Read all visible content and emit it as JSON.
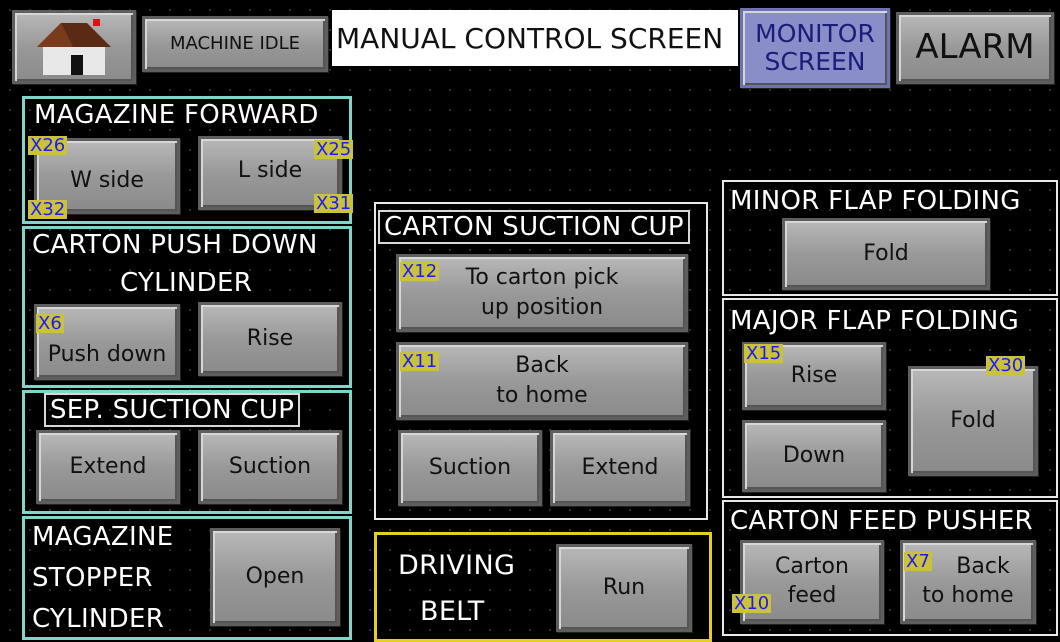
{
  "header": {
    "machine_status": "MACHINE IDLE",
    "screen_title": "MANUAL CONTROL SCREEN",
    "monitor_line1": "MONITOR",
    "monitor_line2": "SCREEN",
    "alarm": "ALARM",
    "home_icon": "home-icon"
  },
  "magazine_forward": {
    "title": "MAGAZINE FORWARD",
    "w_side": "W side",
    "l_side": "L side",
    "tag_x26": "X26",
    "tag_x25": "X25",
    "tag_x32": "X32",
    "tag_x31": "X31"
  },
  "carton_push_down": {
    "title_line1": "CARTON PUSH DOWN",
    "title_line2": "CYLINDER",
    "push_down": "Push down",
    "rise": "Rise",
    "tag_x6": "X6"
  },
  "sep_suction_cup": {
    "title": "SEP. SUCTION CUP",
    "extend": "Extend",
    "suction": "Suction"
  },
  "magazine_stopper": {
    "title_line1": "MAGAZINE",
    "title_line2": "STOPPER",
    "title_line3": "CYLINDER",
    "open": "Open"
  },
  "carton_suction_cup": {
    "title": "CARTON SUCTION CUP",
    "pick_line1": "To carton pick",
    "pick_line2": "up position",
    "back_line1": "Back",
    "back_line2": "to home",
    "suction": "Suction",
    "extend": "Extend",
    "tag_x12": "X12",
    "tag_x11": "X11"
  },
  "driving_belt": {
    "title_line1": "DRIVING",
    "title_line2": "BELT",
    "run": "Run"
  },
  "minor_flap": {
    "title": "MINOR FLAP FOLDING",
    "fold": "Fold"
  },
  "major_flap": {
    "title": "MAJOR FLAP FOLDING",
    "rise": "Rise",
    "down": "Down",
    "fold": "Fold",
    "tag_x15": "X15",
    "tag_x30": "X30"
  },
  "carton_feed_pusher": {
    "title": "CARTON FEED PUSHER",
    "feed_line1": "Carton",
    "feed_line2": "feed",
    "back_line1": "Back",
    "back_line2": "to home",
    "tag_x10": "X10",
    "tag_x7": "X7"
  },
  "colors": {
    "frame_teal": "#7ed6c8",
    "frame_yellow": "#e6cf1e",
    "tag_text": "#1a1aff",
    "tag_bg": "#c9c23a",
    "monitor_bg": "#8a8ec8"
  }
}
